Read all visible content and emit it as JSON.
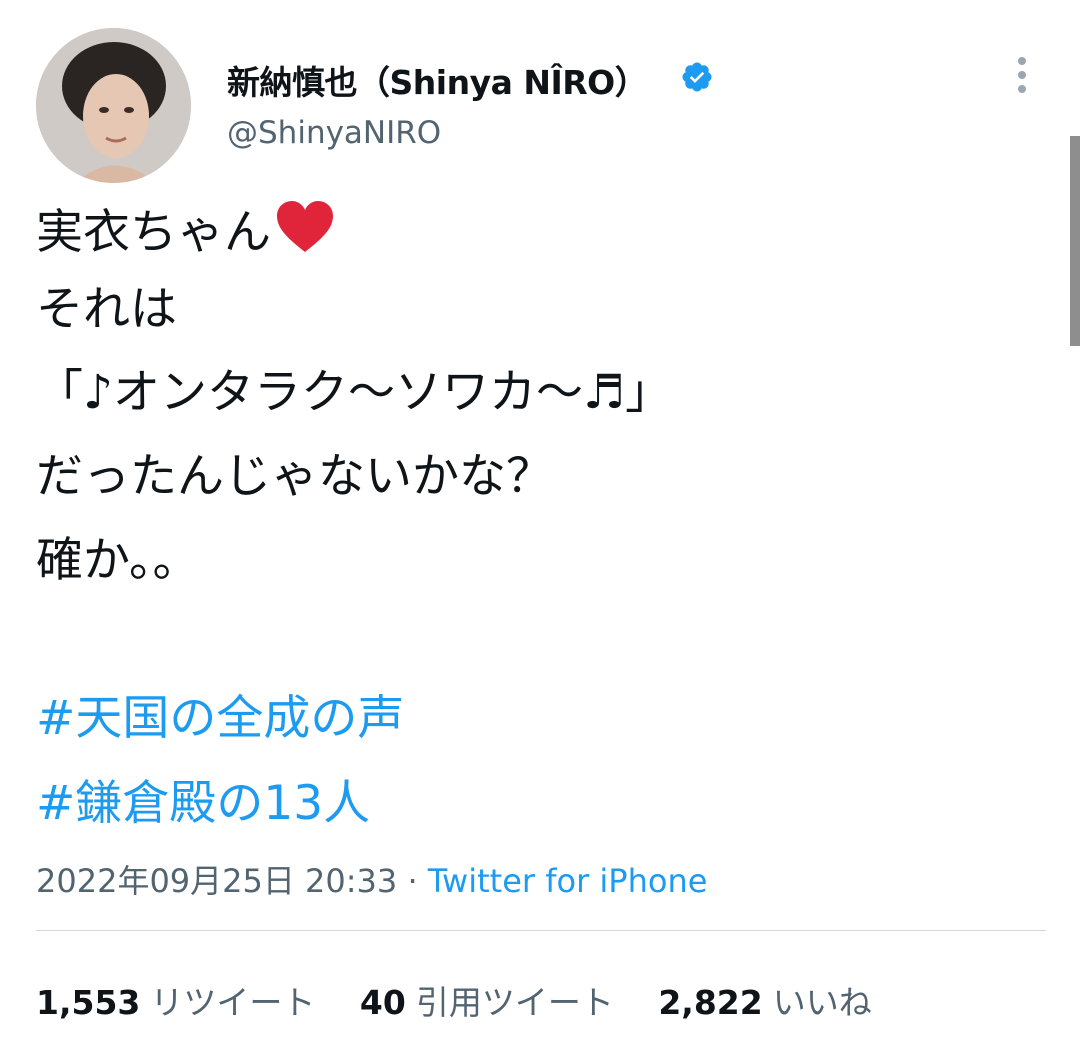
{
  "author": {
    "display_name": "新納慎也（Shinya NÎRO）",
    "handle": "@ShinyaNIRO",
    "verified": true,
    "avatar_icon": "user-avatar-photo"
  },
  "tweet": {
    "lines": [
      "実衣ちゃん",
      "それは",
      "「♪オンタラク〜ソワカ〜♬」",
      "だったんじゃないかな？",
      "確か。。"
    ],
    "emoji": "heart-emoji",
    "hashtags": [
      "#天国の全成の声",
      "#鎌倉殿の13人"
    ]
  },
  "meta": {
    "timestamp": "2022年09月25日 20:33 · ",
    "source": "Twitter for iPhone"
  },
  "stats": {
    "retweets": {
      "count": "1,553",
      "label": "リツイート"
    },
    "quotes": {
      "count": "40",
      "label": "引用ツイート"
    },
    "likes": {
      "count": "2,822",
      "label": "いいね"
    }
  },
  "colors": {
    "link": "#1d9bf0",
    "secondary_text": "#536471",
    "heart": "#e0243a",
    "verified": "#1d9bf0"
  }
}
